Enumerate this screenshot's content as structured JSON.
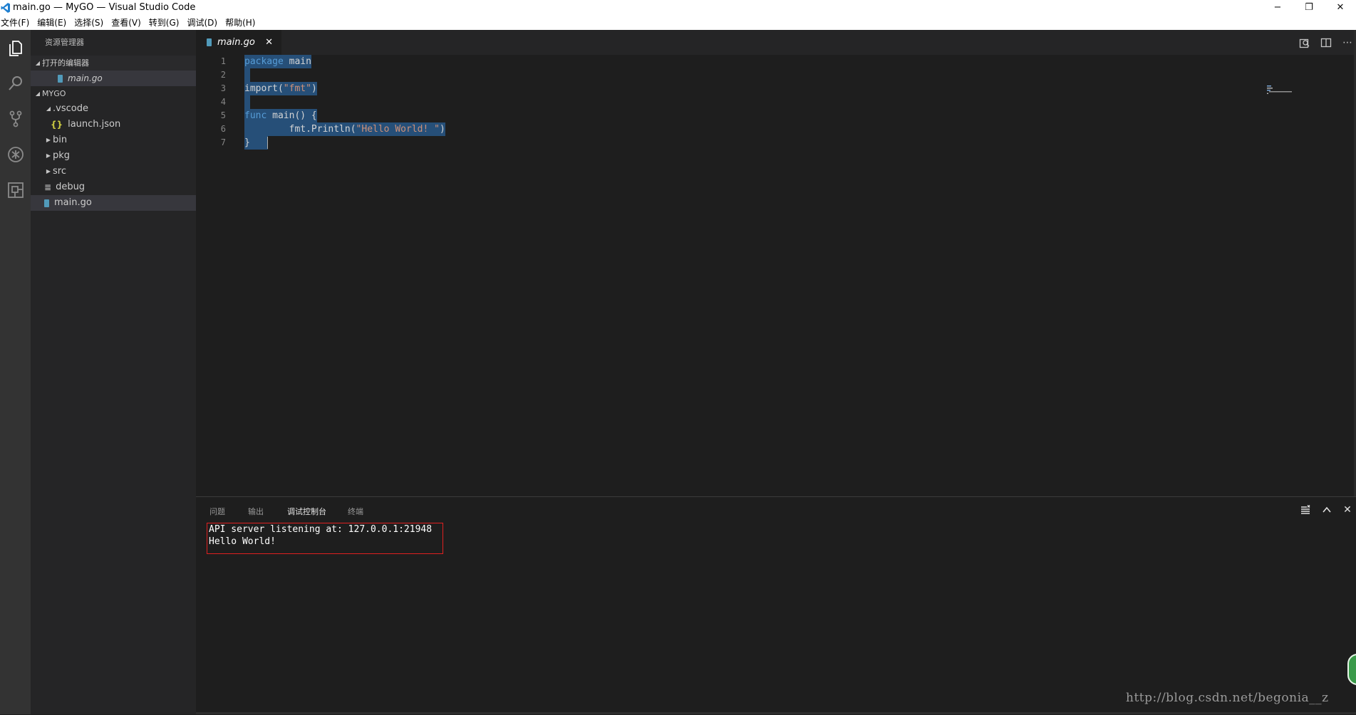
{
  "window": {
    "title": "main.go — MyGO — Visual Studio Code",
    "minimize": "−",
    "restore": "❐",
    "close": "✕"
  },
  "menu": [
    "文件(F)",
    "编辑(E)",
    "选择(S)",
    "查看(V)",
    "转到(G)",
    "调试(D)",
    "帮助(H)"
  ],
  "activity": [
    "explorer-icon",
    "search-icon",
    "source-control-icon",
    "debug-icon",
    "extensions-icon"
  ],
  "sidebar": {
    "title": "资源管理器",
    "open_editors": {
      "label": "打开的编辑器",
      "items": [
        {
          "name": "main.go"
        }
      ]
    },
    "project": {
      "label": "MYGO",
      "tree": [
        {
          "name": ".vscode",
          "type": "folder-open"
        },
        {
          "name": "launch.json",
          "type": "json"
        },
        {
          "name": "bin",
          "type": "folder"
        },
        {
          "name": "pkg",
          "type": "folder"
        },
        {
          "name": "src",
          "type": "folder"
        },
        {
          "name": "debug",
          "type": "file"
        },
        {
          "name": "main.go",
          "type": "go"
        }
      ]
    }
  },
  "editor": {
    "tab": {
      "label": "main.go",
      "close": "✕"
    },
    "lines": [
      {
        "num": "1",
        "parts": [
          {
            "t": "package",
            "c": "kw"
          },
          {
            "t": " main",
            "c": ""
          }
        ]
      },
      {
        "num": "2",
        "parts": [
          {
            "t": " ",
            "c": ""
          }
        ]
      },
      {
        "num": "3",
        "parts": [
          {
            "t": "import(",
            "c": ""
          },
          {
            "t": "\"fmt\"",
            "c": "str"
          },
          {
            "t": ")",
            "c": ""
          }
        ]
      },
      {
        "num": "4",
        "parts": [
          {
            "t": " ",
            "c": ""
          }
        ]
      },
      {
        "num": "5",
        "parts": [
          {
            "t": "func",
            "c": "kw"
          },
          {
            "t": " main() {",
            "c": ""
          }
        ]
      },
      {
        "num": "6",
        "parts": [
          {
            "t": "        fmt.Println(",
            "c": ""
          },
          {
            "t": "\"Hello World! \"",
            "c": "str"
          },
          {
            "t": ")",
            "c": ""
          }
        ]
      },
      {
        "num": "7",
        "parts": [
          {
            "t": "}   ",
            "c": ""
          }
        ]
      }
    ]
  },
  "panel": {
    "tabs": [
      "问题",
      "输出",
      "调试控制台",
      "终端"
    ],
    "active_tab": "调试控制台",
    "console": [
      "API server listening at: 127.0.0.1:21948",
      "Hello World!"
    ]
  },
  "watermark": "http://blog.csdn.net/begonia__z",
  "colors": {
    "activity_bar": "#333333",
    "sidebar": "#252526",
    "editor": "#1e1e1e",
    "selection": "#264f78",
    "keyword": "#569cd6",
    "string": "#ce9178",
    "highlight_box": "#e02020"
  }
}
